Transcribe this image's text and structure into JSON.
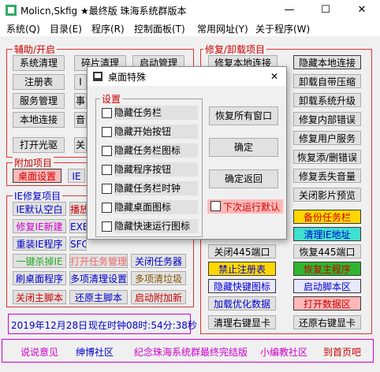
{
  "window": {
    "title": "Molicn,Skfig ★最终版 珠海系统群版本",
    "minimize": "—",
    "maximize": "☐",
    "close": "✕"
  },
  "menu": [
    "系统(Q)",
    "目录(E)",
    "程序(R)",
    "控制面板(T)",
    "常用网址(Y)",
    "关于程序(W)"
  ],
  "groups": {
    "assist": "辅助/开启",
    "repair": "修复/卸载项目",
    "addon": "附加项目",
    "ie": "IE修复项目"
  },
  "assist_buttons": [
    "系统清理",
    "碎片清理",
    "启动管理",
    "注册表",
    "服务管理",
    "本地连接",
    "打开光驱"
  ],
  "assist_partial": [
    "I",
    "事",
    "音",
    "关"
  ],
  "addon_buttons": [
    "桌面设置",
    "IE"
  ],
  "ie_buttons": [
    "IE默认空白",
    "播放",
    "修复IE新建",
    "EXE修",
    "重装IE程序",
    "SFC系统",
    "一键杀掉IE",
    "打开任务管理",
    "关闭任务器",
    "刷桌面程序",
    "多项清理设置",
    "多项清垃圾",
    "关闭主脚本",
    "还原主脚本",
    "启动附加新"
  ],
  "repair_left_buttons": [
    "修复本地连接",
    "关闭445端口",
    "禁止注册表",
    "隐藏快键图标",
    "加载优化数据",
    "清理右键显卡"
  ],
  "repair_right_buttons": [
    "隐藏本地连接",
    "卸载自带压缩",
    "卸载系统升级",
    "修复内部错误",
    "修复用户服务",
    "恢复添/删错误",
    "修复丢失音量",
    "关闭影片预览",
    "备份任务栏",
    "清理IE地址",
    "恢复445端口",
    "恢复主程序",
    "启动脚本区",
    "打开数据区",
    "还原右键显卡"
  ],
  "dialog": {
    "title": "桌面特殊",
    "close": "✕",
    "group": "设置",
    "options": [
      "隐藏任务栏",
      "隐藏开始按钮",
      "隐藏任务栏图标",
      "隐藏程序按钮",
      "隐藏任务栏时钟",
      "隐藏桌面图标",
      "隐藏快速运行图标"
    ],
    "buttons": [
      "恢复所有窗口",
      "确定",
      "确定返回"
    ],
    "next_run": "下次运行默认"
  },
  "status": {
    "date": "2019年12月28日",
    "time_prefix": "现在时钟08时:54分:38秒"
  },
  "bottom_links": [
    "说说意见",
    "绅博社区",
    "纪念珠海系统群最终完结版",
    "小编教社区",
    "到首页吧"
  ],
  "colors": {
    "red": "#cc0000",
    "magenta": "#c000c0",
    "blue": "#0000cc"
  }
}
